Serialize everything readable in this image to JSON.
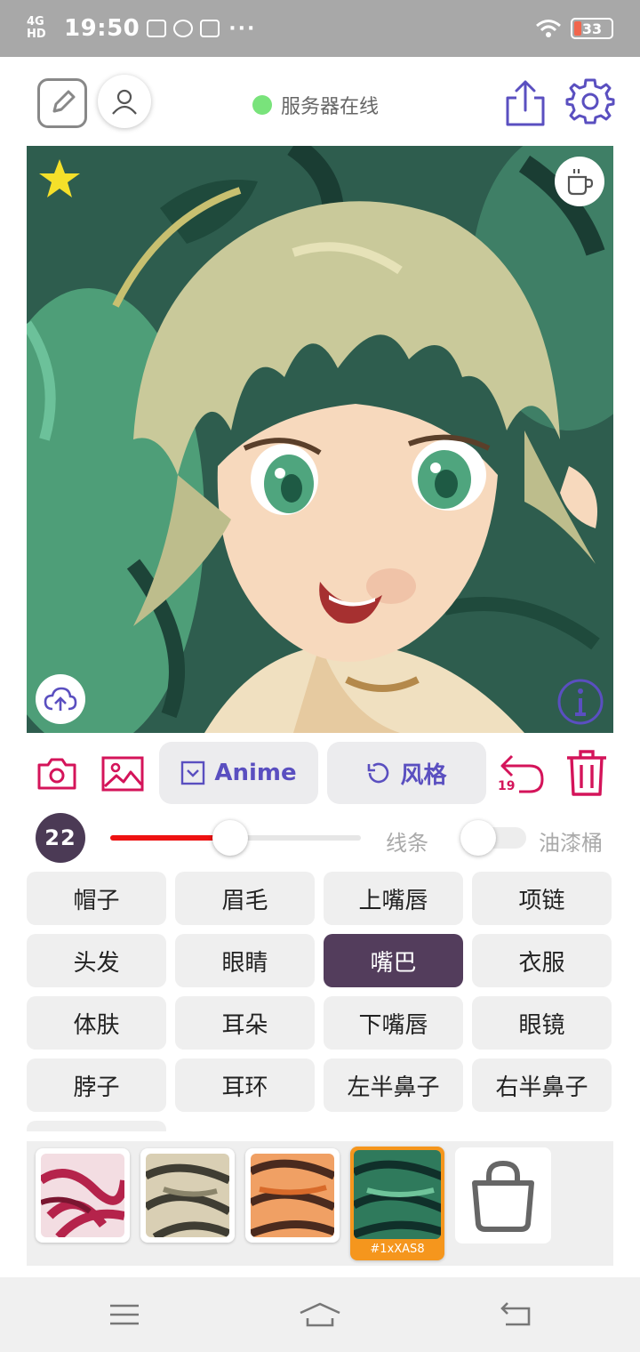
{
  "status_bar": {
    "network": "4G HD",
    "time": "19:50",
    "more": "···",
    "battery": "33",
    "battery_color": "#f1664d"
  },
  "header": {
    "server_status": "服务器在线",
    "status_color": "#79e37b",
    "icons": [
      "edit-icon",
      "user-icon",
      "share-icon",
      "gear-icon"
    ]
  },
  "canvas": {
    "icons": [
      "star-icon",
      "coffee-icon",
      "cloud-upload-icon",
      "info-icon"
    ],
    "star_color": "#f5e02a"
  },
  "toolbar": {
    "model_label": "Anime",
    "style_label": "风格",
    "undo_count": "19",
    "accent_color": "#d4145a",
    "button_text_color": "#5a4fc0"
  },
  "brush": {
    "size": "22",
    "slider_level": 0.48,
    "line_label": "线条",
    "line_toggle_on": false,
    "bucket_label": "油漆桶"
  },
  "parts": [
    {
      "label": "帽子",
      "selected": false
    },
    {
      "label": "眉毛",
      "selected": false
    },
    {
      "label": "上嘴唇",
      "selected": false
    },
    {
      "label": "项链",
      "selected": false
    },
    {
      "label": "头发",
      "selected": false
    },
    {
      "label": "眼睛",
      "selected": false
    },
    {
      "label": "嘴巴",
      "selected": true
    },
    {
      "label": "衣服",
      "selected": false
    },
    {
      "label": "体肤",
      "selected": false
    },
    {
      "label": "耳朵",
      "selected": false
    },
    {
      "label": "下嘴唇",
      "selected": false
    },
    {
      "label": "眼镜",
      "selected": false
    },
    {
      "label": "脖子",
      "selected": false
    },
    {
      "label": "耳环",
      "selected": false
    },
    {
      "label": "左半鼻子",
      "selected": false
    },
    {
      "label": "右半鼻子",
      "selected": false
    }
  ],
  "styles": {
    "selected_tag": "#1xXAS8",
    "selected_color": "#f5961d",
    "shop_icon": "shopping-bag-icon"
  },
  "nav": {
    "icons": [
      "menu-icon",
      "home-icon",
      "back-icon"
    ]
  }
}
